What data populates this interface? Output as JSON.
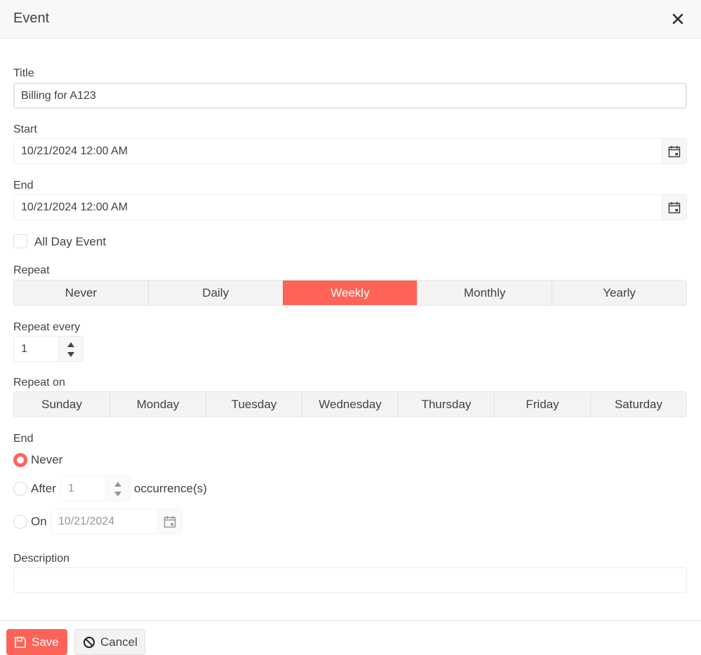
{
  "dialog": {
    "title": "Event",
    "close_icon": "close-icon"
  },
  "form": {
    "title_label": "Title",
    "title_value": "Billing for A123",
    "start_label": "Start",
    "start_value": "10/21/2024 12:00 AM",
    "end_label": "End",
    "end_value": "10/21/2024 12:00 AM",
    "all_day_label": "All Day Event",
    "all_day_checked": false,
    "repeat_label": "Repeat",
    "repeat_options": [
      "Never",
      "Daily",
      "Weekly",
      "Monthly",
      "Yearly"
    ],
    "repeat_selected": "Weekly",
    "repeat_every_label": "Repeat every",
    "repeat_every_value": "1",
    "repeat_on_label": "Repeat on",
    "repeat_on_days": [
      "Sunday",
      "Monday",
      "Tuesday",
      "Wednesday",
      "Thursday",
      "Friday",
      "Saturday"
    ],
    "end_rule_label": "End",
    "end_never_label": "Never",
    "end_after_label": "After",
    "end_after_value": "1",
    "end_after_suffix": "occurrence(s)",
    "end_on_label": "On",
    "end_on_value": "10/21/2024",
    "end_selected": "Never",
    "description_label": "Description",
    "description_value": ""
  },
  "footer": {
    "save_label": "Save",
    "cancel_label": "Cancel"
  },
  "colors": {
    "accent": "#ff6358"
  }
}
